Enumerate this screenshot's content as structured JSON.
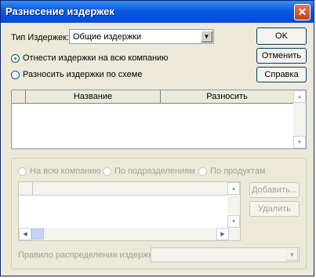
{
  "window": {
    "title": "Разнесение издержек"
  },
  "type": {
    "label": "Тип Издержек:",
    "value": "Общие издержки"
  },
  "buttons": {
    "ok": "OK",
    "cancel": "Отменить",
    "help": "Справка"
  },
  "scope": {
    "company": {
      "label": "Отнести издержки на всю компанию",
      "selected": true
    },
    "scheme": {
      "label": "Разносить издержки по схеме",
      "selected": false
    }
  },
  "main_grid": {
    "columns": [
      "",
      "Название",
      "Разносить"
    ],
    "rows": []
  },
  "scheme": {
    "options": [
      {
        "label": "На всю компанию"
      },
      {
        "label": "По подразделениям"
      },
      {
        "label": "По продуктам"
      }
    ],
    "grid_rows": [],
    "add_label": "Добавить...",
    "delete_label": "Удалить",
    "rule_label": "Правило распределения издержки:",
    "rule_value": ""
  },
  "icons": {
    "close": "close-icon",
    "dropdown": "chevron-down-icon"
  }
}
